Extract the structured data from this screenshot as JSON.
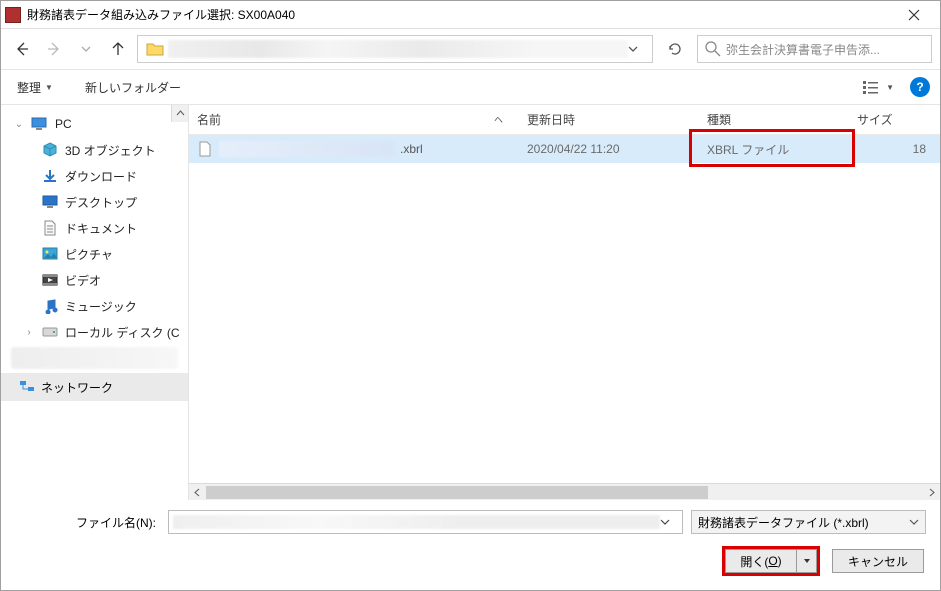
{
  "titlebar": {
    "title": "財務諸表データ組み込みファイル選択: SX00A040"
  },
  "nav": {
    "search_placeholder": "弥生会計決算書電子申告添..."
  },
  "toolbar": {
    "organize": "整理",
    "new_folder": "新しいフォルダー"
  },
  "sidebar": {
    "pc": "PC",
    "items": [
      {
        "label": "3D オブジェクト",
        "icon": "cube-icon"
      },
      {
        "label": "ダウンロード",
        "icon": "download-icon"
      },
      {
        "label": "デスクトップ",
        "icon": "desktop-icon"
      },
      {
        "label": "ドキュメント",
        "icon": "document-icon"
      },
      {
        "label": "ピクチャ",
        "icon": "pictures-icon"
      },
      {
        "label": "ビデオ",
        "icon": "video-icon"
      },
      {
        "label": "ミュージック",
        "icon": "music-icon"
      },
      {
        "label": "ローカル ディスク (C",
        "icon": "disk-icon"
      }
    ],
    "network": "ネットワーク"
  },
  "columns": {
    "name": "名前",
    "date": "更新日時",
    "kind": "種類",
    "size": "サイズ"
  },
  "files": [
    {
      "name_suffix": ".xbrl",
      "date": "2020/04/22 11:20",
      "kind": "XBRL ファイル",
      "size": "18"
    }
  ],
  "footer": {
    "filename_label": "ファイル名(N):",
    "filter_label": "財務諸表データファイル (*.xbrl)",
    "open_prefix": "開く(",
    "open_key": "O",
    "open_suffix": ")",
    "cancel": "キャンセル"
  }
}
